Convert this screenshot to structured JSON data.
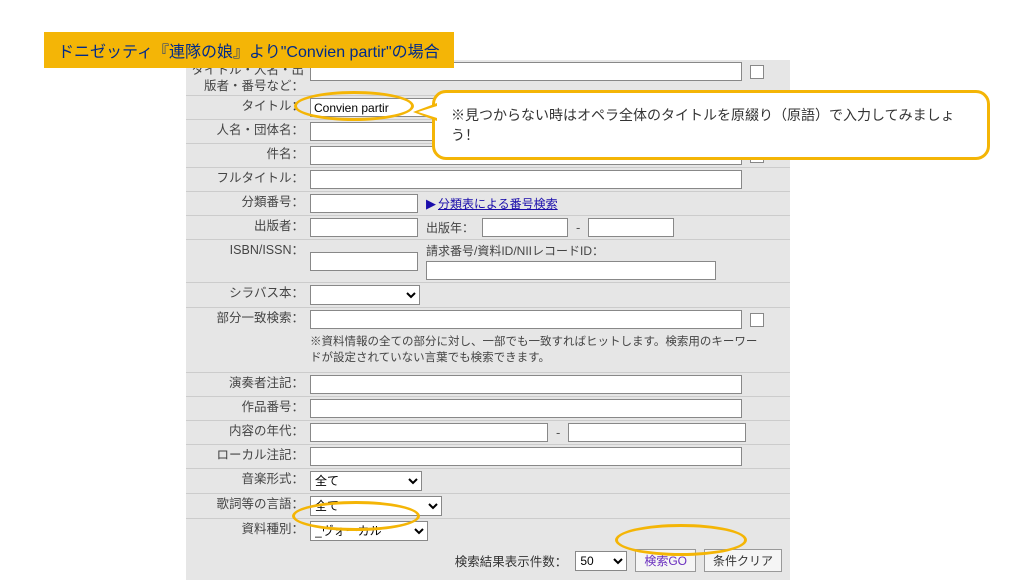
{
  "banner": "ドニゼッティ『連隊の娘』より\"Convien partir\"の場合",
  "callout": "※見つからない時はオペラ全体のタイトルを原綴り（原語）で入力してみましょう！",
  "labels": {
    "titlePersonEtc": "タイトル・人名・出版者・番号など：",
    "title": "タイトル：",
    "nameOrg": "人名・団体名：",
    "subject": "件名：",
    "fullTitle": "フルタイトル：",
    "classNo": "分類番号：",
    "publisher": "出版者：",
    "pubYear": "出版年：",
    "isbn": "ISBN/ISSN：",
    "callNo": "請求番号/資料ID/NIIレコードID：",
    "syllabus": "シラバス本：",
    "partial": "部分一致検索：",
    "performer": "演奏者注記：",
    "workNo": "作品番号：",
    "era": "内容の年代：",
    "localNote": "ローカル注記：",
    "form": "音楽形式：",
    "lang": "歌詞等の言語：",
    "docType": "資料種別：",
    "resultCount": "検索結果表示件数："
  },
  "values": {
    "title": "Convien partir",
    "form": "全て",
    "lang": "全て",
    "docType": "_ヴォーカル",
    "resultCount": "50"
  },
  "classLink": "分類表による番号検索",
  "partialNote": "※資料情報の全ての部分に対し、一部でも一致すればヒットします。検索用のキーワードが設定されていない言葉でも検索できます。",
  "buttons": {
    "go": "検索GO",
    "clear": "条件クリア"
  },
  "dash": "-"
}
